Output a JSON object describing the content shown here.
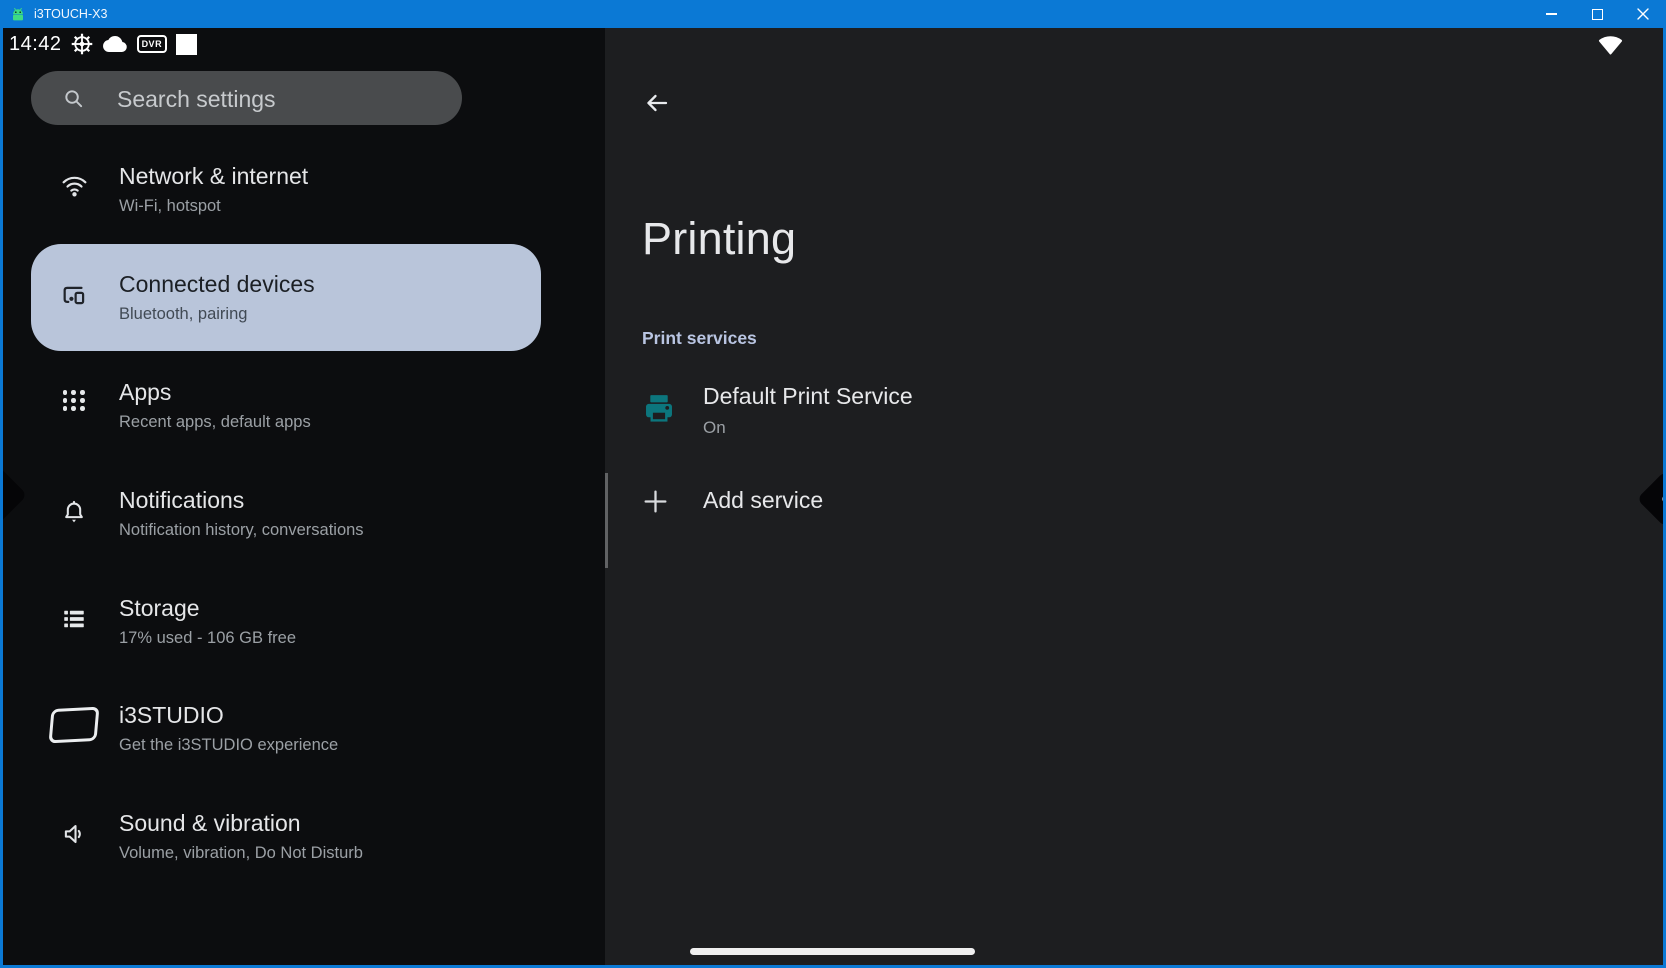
{
  "window": {
    "title": "i3TOUCH-X3"
  },
  "status_bar": {
    "time": "14:42",
    "dvr_label": "DVR",
    "left_icons": [
      "settings-gear",
      "cloud",
      "dvr-badge",
      "blank-square"
    ],
    "right_icons": [
      "wifi-full"
    ]
  },
  "sidebar": {
    "search": {
      "placeholder": "Search settings"
    },
    "items": [
      {
        "icon": "wifi",
        "title": "Network & internet",
        "subtitle": "Wi-Fi, hotspot",
        "selected": false
      },
      {
        "icon": "devices",
        "title": "Connected devices",
        "subtitle": "Bluetooth, pairing",
        "selected": true
      },
      {
        "icon": "apps-grid",
        "title": "Apps",
        "subtitle": "Recent apps, default apps",
        "selected": false
      },
      {
        "icon": "bell",
        "title": "Notifications",
        "subtitle": "Notification history, conversations",
        "selected": false
      },
      {
        "icon": "storage",
        "title": "Storage",
        "subtitle": "17% used - 106 GB free",
        "selected": false
      },
      {
        "icon": "screen",
        "title": "i3STUDIO",
        "subtitle": "Get the i3STUDIO experience",
        "selected": false
      },
      {
        "icon": "speaker",
        "title": "Sound & vibration",
        "subtitle": "Volume, vibration, Do Not Disturb",
        "selected": false
      }
    ]
  },
  "content": {
    "page_title": "Printing",
    "section_header": "Print services",
    "services": [
      {
        "title": "Default Print Service",
        "status": "On"
      }
    ],
    "add_service_label": "Add service"
  },
  "colors": {
    "titlebar_blue": "#0b79d5",
    "sidebar_bg": "#0c0d0f",
    "detail_bg": "#1d1e20",
    "selected_item_bg": "#b9c5da",
    "section_header_text": "#b9c5e2",
    "printer_icon_teal": "#0c767d",
    "android_green": "#3ddc84"
  }
}
